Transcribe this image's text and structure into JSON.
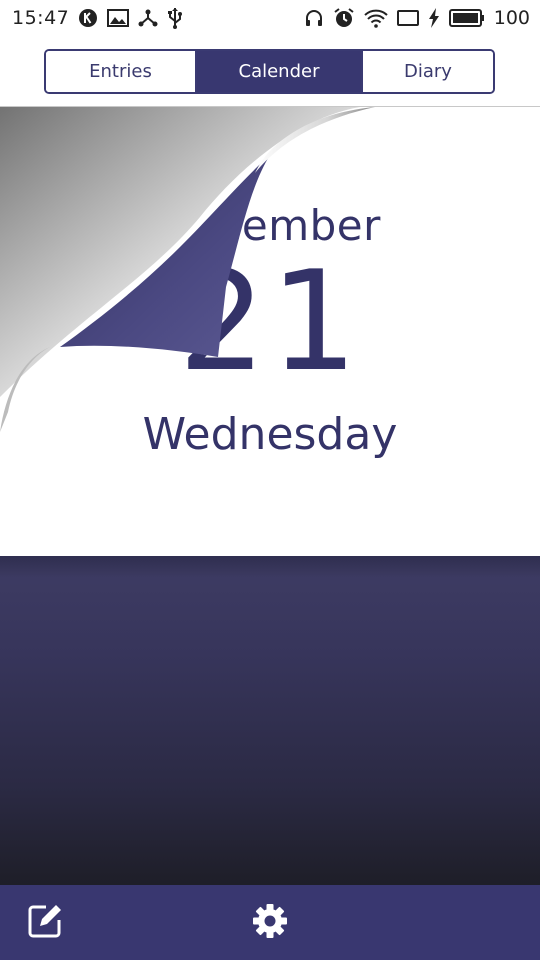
{
  "status_bar": {
    "time": "15:47",
    "left_icons": [
      "k-notification-icon",
      "image-icon",
      "share-hub-icon",
      "usb-icon"
    ],
    "right_icons": [
      "headphones-icon",
      "alarm-icon",
      "wifi-icon",
      "screen-cast-icon",
      "charging-bolt-icon",
      "battery-icon"
    ],
    "battery_level": "100"
  },
  "tabs": [
    {
      "label": "Entries",
      "active": false
    },
    {
      "label": "Calender",
      "active": true
    },
    {
      "label": "Diary",
      "active": false
    }
  ],
  "calendar": {
    "month": "December",
    "day": "21",
    "weekday": "Wednesday"
  },
  "toolbar": {
    "icons": [
      "edit-icon",
      "settings-gear-icon"
    ]
  },
  "colors": {
    "primary": "#383770",
    "text": "#343368",
    "curl_back": "#4e4c86",
    "backdrop_top": "#3e3c64",
    "backdrop_bottom": "#1e1e28"
  }
}
